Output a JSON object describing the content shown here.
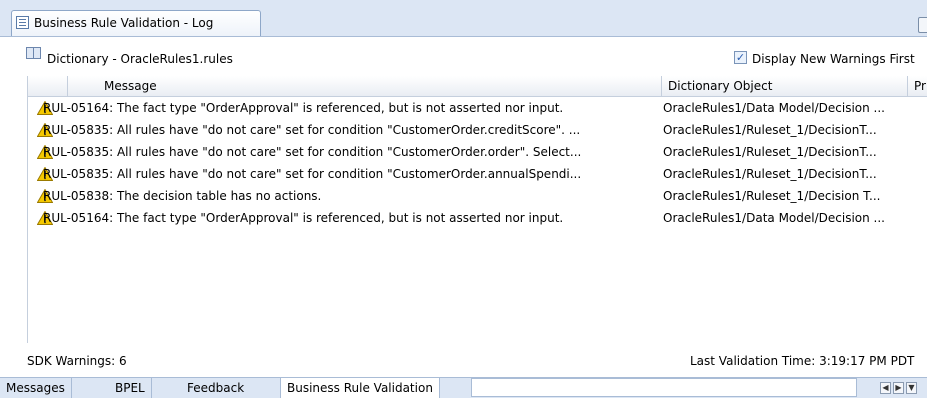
{
  "window": {
    "title": "Business Rule Validation - Log"
  },
  "infobar": {
    "dictionary_label": "Dictionary - OracleRules1.rules",
    "checkbox_label": "Display New Warnings First",
    "checkbox_checked": true
  },
  "table": {
    "columns": [
      "Message",
      "Dictionary Object",
      "Pr"
    ],
    "rows": [
      {
        "icon": "warning-icon",
        "message": "RUL-05164: The fact type \"OrderApproval\" is referenced, but is not asserted nor input.",
        "object": "OracleRules1/Data Model/Decision ..."
      },
      {
        "icon": "warning-icon",
        "message": "RUL-05835: All rules have \"do not care\" set for condition \"CustomerOrder.creditScore\".  ...",
        "object": "OracleRules1/Ruleset_1/DecisionT..."
      },
      {
        "icon": "warning-icon",
        "message": "RUL-05835: All rules have \"do not care\" set for condition \"CustomerOrder.order\".  Select...",
        "object": "OracleRules1/Ruleset_1/DecisionT..."
      },
      {
        "icon": "warning-icon",
        "message": "RUL-05835: All rules have \"do not care\" set for condition \"CustomerOrder.annualSpendi...",
        "object": "OracleRules1/Ruleset_1/DecisionT..."
      },
      {
        "icon": "warning-icon",
        "message": "RUL-05838: The decision table has no actions.",
        "object": "OracleRules1/Ruleset_1/Decision T..."
      },
      {
        "icon": "warning-icon",
        "message": "RUL-05164: The fact type \"OrderApproval\" is referenced, but is not asserted nor input.",
        "object": "OracleRules1/Data Model/Decision ..."
      }
    ]
  },
  "status": {
    "warnings": "SDK Warnings: 6",
    "last_validation": "Last Validation Time: 3:19:17 PM PDT"
  },
  "bottom_tabs": [
    "Messages",
    "BPEL",
    "Feedback",
    "Business Rule Validation"
  ],
  "colors": {
    "tab_strip": "#dce6f4",
    "warning_yellow": "#f5c800",
    "accent_blue": "#2a5db0"
  }
}
